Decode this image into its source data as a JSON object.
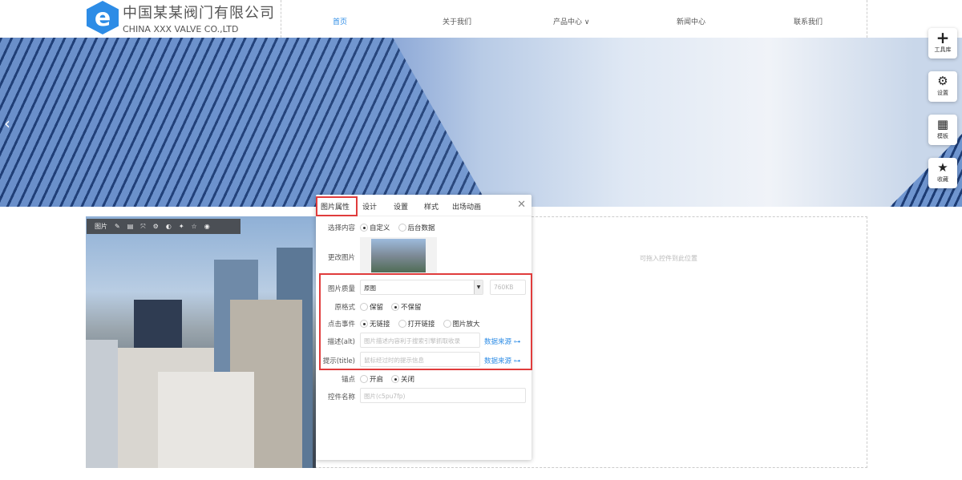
{
  "header": {
    "logo_cn": "中国某某阀门有限公司",
    "logo_en": "CHINA XXX VALVE CO.,LTD",
    "nav": [
      {
        "label": "首页"
      },
      {
        "label": "关于我们"
      },
      {
        "label": "产品中心 ∨"
      },
      {
        "label": "新闻中心"
      },
      {
        "label": "联系我们"
      }
    ]
  },
  "side_tools": [
    {
      "icon": "plus",
      "label": "工具库"
    },
    {
      "icon": "gears",
      "label": "设置"
    },
    {
      "icon": "grid",
      "label": "模板"
    },
    {
      "icon": "star",
      "label": "收藏"
    }
  ],
  "canvas": {
    "drop_hint": "可拖入控件到此位置",
    "toolbar_label": "图片"
  },
  "panel": {
    "tabs": [
      "图片属性",
      "设计",
      "设置",
      "样式",
      "出场动画"
    ],
    "select_content": {
      "label": "选择内容",
      "options": [
        "自定义",
        "后台数据"
      ],
      "selected": 0
    },
    "change_image": {
      "label": "更改图片"
    },
    "quality": {
      "label": "图片质量",
      "value": "原图",
      "size": "760KB"
    },
    "original_format": {
      "label": "原格式",
      "options": [
        "保留",
        "不保留"
      ],
      "selected": 1
    },
    "click_event": {
      "label": "点击事件",
      "options": [
        "无链接",
        "打开链接",
        "图片放大"
      ],
      "selected": 0
    },
    "alt": {
      "label": "描述(alt)",
      "placeholder": "图片描述内容利于搜索引擎抓取收录",
      "source": "数据来源"
    },
    "title": {
      "label": "提示(title)",
      "placeholder": "鼠标经过时的提示信息",
      "source": "数据来源"
    },
    "anchor": {
      "label": "锚点",
      "options": [
        "开启",
        "关闭"
      ],
      "selected": 1
    },
    "control_name": {
      "label": "控件名称",
      "placeholder": "图片(c5pu7fp)"
    }
  }
}
